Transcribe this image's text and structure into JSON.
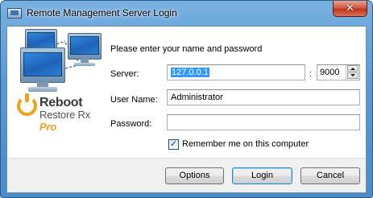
{
  "window": {
    "title": "Remote Management Server Login",
    "close_glyph": "✕"
  },
  "logo": {
    "brand_line1": "Reboot",
    "brand_line2_main": "Restore Rx",
    "brand_line2_accent": "Pro",
    "icon_names": [
      "monitor-network-icon",
      "reboot-power-icon"
    ],
    "accent_color": "#f1a11c"
  },
  "form": {
    "prompt": "Please enter your name and password",
    "server_label": "Server:",
    "server_value": "127.0.0.1",
    "colon": ":",
    "port_value": "9000",
    "username_label": "User Name:",
    "username_value": "Administrator",
    "password_label": "Password:",
    "password_value": "",
    "remember_label": "Remember me on this computer",
    "remember_checked": true,
    "remember_check_glyph": "✓"
  },
  "buttons": {
    "options_label": "Options",
    "login_label": "Login",
    "cancel_label": "Cancel"
  }
}
